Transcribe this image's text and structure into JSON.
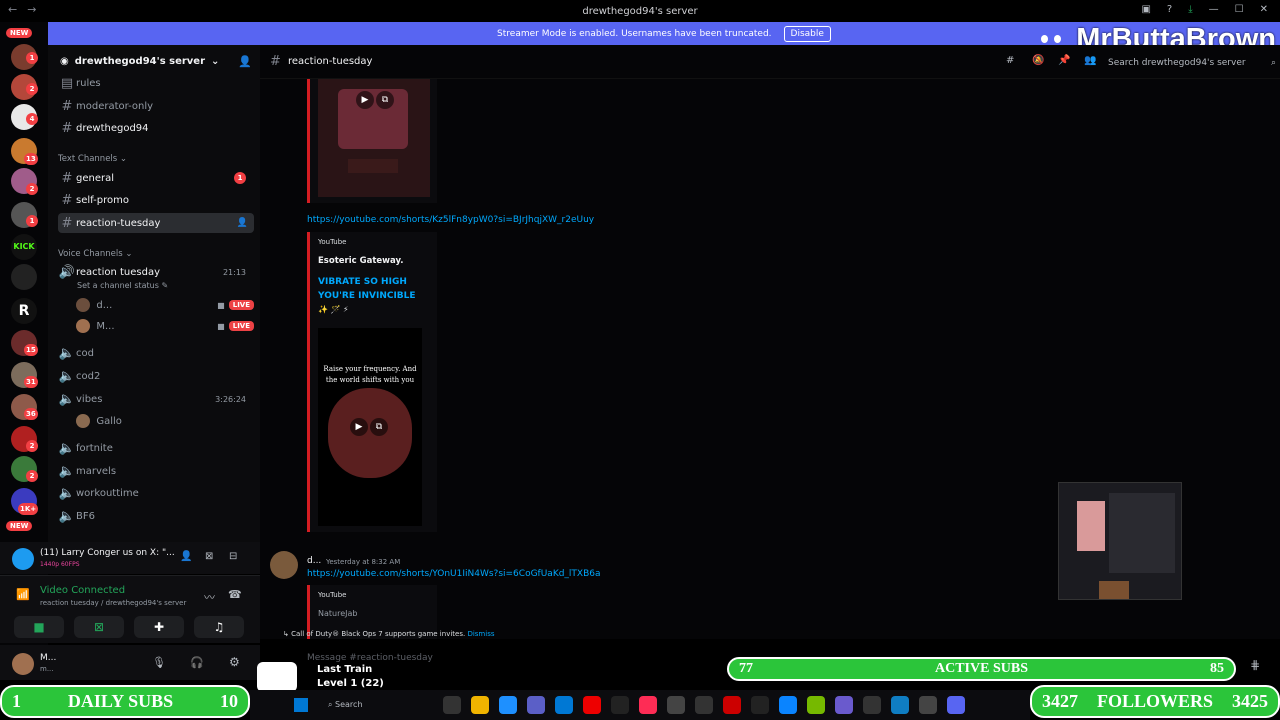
{
  "window": {
    "title": "drewthegod94's server"
  },
  "banner": {
    "text": "Streamer Mode is enabled. Usernames have been truncated.",
    "button": "Disable"
  },
  "brand": {
    "name": "MrButtaBrown"
  },
  "rail": {
    "new_label": "NEW",
    "badges": [
      "1",
      "2",
      "4",
      "13",
      "2",
      "1",
      "15",
      "31",
      "36",
      "2",
      "2",
      "1K+"
    ],
    "new_bottom": "NEW"
  },
  "sidebar": {
    "server_name": "drewthegod94's server",
    "channels_top": [
      {
        "label": "rules"
      },
      {
        "label": "moderator-only"
      },
      {
        "label": "drewthegod94"
      }
    ],
    "text_category": "Text Channels",
    "text_channels": [
      {
        "label": "general",
        "badge": "1"
      },
      {
        "label": "self-promo"
      },
      {
        "label": "reaction-tuesday"
      }
    ],
    "voice_category": "Voice Channels",
    "voice_channel": {
      "label": "reaction tuesday",
      "timer": "21:13",
      "status": "Set a channel status"
    },
    "voice_users": [
      {
        "name": "d...",
        "live": "LIVE"
      },
      {
        "name": "M...",
        "live": "LIVE"
      }
    ],
    "voice_channels": [
      {
        "label": "cod"
      },
      {
        "label": "cod2"
      },
      {
        "label": "vibes",
        "timer": "3:26:24"
      }
    ],
    "vibes_user": "Gallo",
    "voice_channels_2": [
      {
        "label": "fortnite"
      },
      {
        "label": "marvels"
      },
      {
        "label": "workouttime"
      },
      {
        "label": "BF6"
      }
    ]
  },
  "nowplaying": {
    "title": "(11) Larry Conger us on X: \"...",
    "quality": "1440p 60FPS"
  },
  "voice": {
    "status": "Video Connected",
    "channel": "reaction tuesday / drewthegod94's server"
  },
  "user": {
    "name": "M...",
    "sub": "m..."
  },
  "header": {
    "channel": "reaction-tuesday",
    "search_placeholder": "Search drewthegod94's server"
  },
  "messages": {
    "link1": "https://youtube.com/shorts/Kz5lFn8ypW0?si=BJrJhqjXW_r2eUuy",
    "embed1": {
      "provider": "YouTube",
      "author": "Esoteric Gateway.",
      "title": "VIBRATE SO HIGH YOU'RE INVINCIBLE",
      "emojis": "✨ 🪄 ⚡",
      "thumb_text": "Raise your frequency. And the world shifts with you"
    },
    "msg2": {
      "author": "d...",
      "time": "Yesterday at 8:32 AM",
      "link": "https://youtube.com/shorts/YOnU1IiN4Ws?si=6CoGfUaKd_lTXB6a"
    },
    "embed2": {
      "provider": "YouTube",
      "author": "NatureJab"
    }
  },
  "gamebar": {
    "text": "Call of Duty® Black Ops 7 supports game invites.",
    "dismiss": "Dismiss"
  },
  "input": {
    "placeholder": "Message #reaction-tuesday"
  },
  "train": {
    "title": "Last Train",
    "level": "Level 1  (22)"
  },
  "taskbar": {
    "search": "Search"
  },
  "overlays": {
    "active_subs": {
      "left": "77",
      "label": "ACTIVE SUBS",
      "right": "85"
    },
    "daily_subs": {
      "left": "1",
      "label": "DAILY SUBS",
      "right": "10"
    },
    "followers": {
      "left": "3427",
      "label": "FOLLOWERS",
      "right": "3425"
    }
  },
  "colors": {
    "accent": "#5865f2",
    "live": "#ed4245",
    "embed_bar": "#d51d22",
    "link": "#00a8fc",
    "overlay_green": "#2bc53a"
  }
}
